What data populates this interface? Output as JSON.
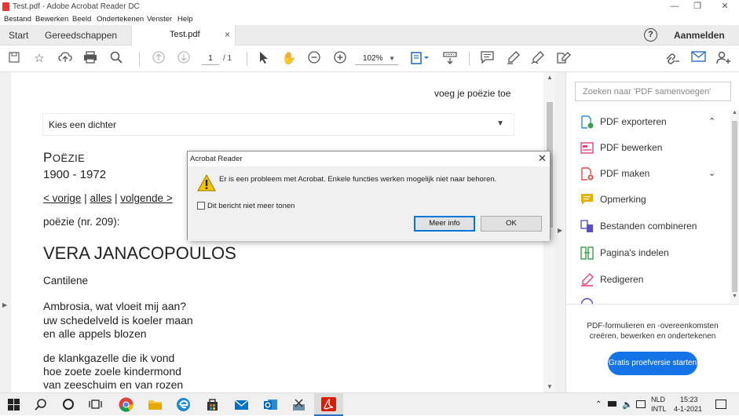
{
  "window": {
    "title": "Test.pdf - Adobe Acrobat Reader DC"
  },
  "menu": [
    "Bestand",
    "Bewerken",
    "Beeld",
    "Ondertekenen",
    "Venster",
    "Help"
  ],
  "tabs": {
    "start": "Start",
    "tools": "Gereedschappen",
    "file": "Test.pdf",
    "close": "×",
    "help": "?",
    "signin": "Aanmelden"
  },
  "toolbar": {
    "page_current": "1",
    "page_total": "/ 1",
    "zoom": "102%"
  },
  "document": {
    "top_right": "voeg je poëzie toe",
    "poet_select": "Kies een dichter",
    "heading_cap": "P",
    "heading_rest": "OËZIE",
    "years": "1900 - 1972",
    "nav_prev": "< vorige",
    "nav_sep1": "|",
    "nav_all": "alles",
    "nav_sep2": "|",
    "nav_next": "volgende >",
    "poem_no": "poëzie (nr. 209):",
    "poet_name": "VERA JANACOPOULOS",
    "poem_title": "Cantilene",
    "stanza1": [
      "Ambrosia, wat vloeit mij aan?",
      "uw schedelveld is koeler maan",
      "en alle appels blozen"
    ],
    "stanza2": [
      "de klankgazelle die ik vond",
      "hoe zoete zoele kindermond",
      "van zeeschuim en van rozen"
    ]
  },
  "right_panel": {
    "search_placeholder": "Zoeken naar 'PDF samenvoegen'",
    "tools": [
      {
        "label": "PDF exporteren",
        "icon": "export-pdf-icon",
        "color": "#2f8fcf"
      },
      {
        "label": "PDF bewerken",
        "icon": "edit-pdf-icon",
        "color": "#e0457a"
      },
      {
        "label": "PDF maken",
        "icon": "create-pdf-icon",
        "color": "#e14848"
      },
      {
        "label": "Opmerking",
        "icon": "comment-icon",
        "color": "#e6b000"
      },
      {
        "label": "Bestanden combineren",
        "icon": "combine-files-icon",
        "color": "#5b4fc9"
      },
      {
        "label": "Pagina's indelen",
        "icon": "organize-pages-icon",
        "color": "#3ea04a"
      },
      {
        "label": "Redigeren",
        "icon": "redact-icon",
        "color": "#e0457a"
      }
    ],
    "promo": "PDF-formulieren en -overeenkomsten creëren, bewerken en ondertekenen",
    "trial_button": "Gratis proefversie starten"
  },
  "dialog": {
    "title": "Acrobat Reader",
    "message": "Er is een probleem met Acrobat. Enkele functies werken mogelijk niet naar behoren.",
    "checkbox_label": "Dit bericht niet meer tonen",
    "more_info": "Meer info",
    "ok": "OK"
  },
  "taskbar": {
    "lang_top": "NLD",
    "lang_bottom": "INTL",
    "time": "15:23",
    "date": "4-1-2021"
  }
}
